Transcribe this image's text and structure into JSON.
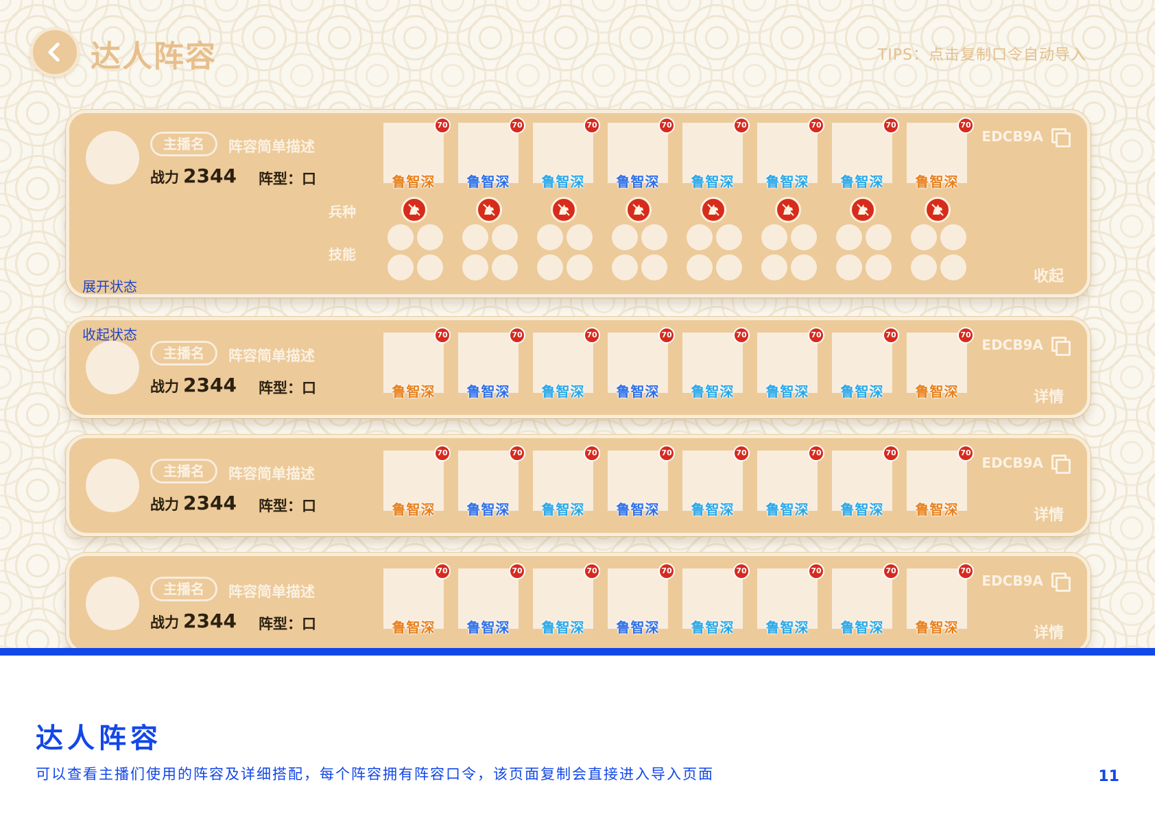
{
  "screen": {
    "title": "达人阵容",
    "tips": "TIPS：点击复制口令自动导入"
  },
  "cards": [
    {
      "state_label": "展开状态",
      "anchor": "主播名",
      "description": "阵容简单描述",
      "power_label": "战力",
      "power": "2344",
      "formation_label": "阵型：",
      "formation": "口",
      "code": "EDCB9A",
      "action": "收起",
      "troop_label": "兵种",
      "skill_label": "技能",
      "heroes": [
        {
          "name": "鲁智深",
          "level": "70",
          "color": "orange"
        },
        {
          "name": "鲁智深",
          "level": "70",
          "color": "blue"
        },
        {
          "name": "鲁智深",
          "level": "70",
          "color": "cyan"
        },
        {
          "name": "鲁智深",
          "level": "70",
          "color": "blue"
        },
        {
          "name": "鲁智深",
          "level": "70",
          "color": "cyan"
        },
        {
          "name": "鲁智深",
          "level": "70",
          "color": "cyan"
        },
        {
          "name": "鲁智深",
          "level": "70",
          "color": "cyan"
        },
        {
          "name": "鲁智深",
          "level": "70",
          "color": "orange"
        }
      ]
    },
    {
      "state_label": "收起状态",
      "anchor": "主播名",
      "description": "阵容简单描述",
      "power_label": "战力",
      "power": "2344",
      "formation_label": "阵型：",
      "formation": "口",
      "code": "EDCB9A",
      "action": "详情",
      "heroes": [
        {
          "name": "鲁智深",
          "level": "70",
          "color": "orange"
        },
        {
          "name": "鲁智深",
          "level": "70",
          "color": "blue"
        },
        {
          "name": "鲁智深",
          "level": "70",
          "color": "cyan"
        },
        {
          "name": "鲁智深",
          "level": "70",
          "color": "blue"
        },
        {
          "name": "鲁智深",
          "level": "70",
          "color": "cyan"
        },
        {
          "name": "鲁智深",
          "level": "70",
          "color": "cyan"
        },
        {
          "name": "鲁智深",
          "level": "70",
          "color": "cyan"
        },
        {
          "name": "鲁智深",
          "level": "70",
          "color": "orange"
        }
      ]
    },
    {
      "anchor": "主播名",
      "description": "阵容简单描述",
      "power_label": "战力",
      "power": "2344",
      "formation_label": "阵型：",
      "formation": "口",
      "code": "EDCB9A",
      "action": "详情",
      "heroes": [
        {
          "name": "鲁智深",
          "level": "70",
          "color": "orange"
        },
        {
          "name": "鲁智深",
          "level": "70",
          "color": "blue"
        },
        {
          "name": "鲁智深",
          "level": "70",
          "color": "cyan"
        },
        {
          "name": "鲁智深",
          "level": "70",
          "color": "blue"
        },
        {
          "name": "鲁智深",
          "level": "70",
          "color": "cyan"
        },
        {
          "name": "鲁智深",
          "level": "70",
          "color": "cyan"
        },
        {
          "name": "鲁智深",
          "level": "70",
          "color": "cyan"
        },
        {
          "name": "鲁智深",
          "level": "70",
          "color": "orange"
        }
      ]
    },
    {
      "anchor": "主播名",
      "description": "阵容简单描述",
      "power_label": "战力",
      "power": "2344",
      "formation_label": "阵型：",
      "formation": "口",
      "code": "EDCB9A",
      "action": "详情",
      "heroes": [
        {
          "name": "鲁智深",
          "level": "70",
          "color": "orange"
        },
        {
          "name": "鲁智深",
          "level": "70",
          "color": "blue"
        },
        {
          "name": "鲁智深",
          "level": "70",
          "color": "cyan"
        },
        {
          "name": "鲁智深",
          "level": "70",
          "color": "blue"
        },
        {
          "name": "鲁智深",
          "level": "70",
          "color": "cyan"
        },
        {
          "name": "鲁智深",
          "level": "70",
          "color": "cyan"
        },
        {
          "name": "鲁智深",
          "level": "70",
          "color": "cyan"
        },
        {
          "name": "鲁智深",
          "level": "70",
          "color": "orange"
        }
      ]
    }
  ],
  "caption": {
    "title": "达人阵容",
    "text": "可以查看主播们使用的阵容及详细搭配，每个阵容拥有阵容口令，该页面复制会直接进入导入页面",
    "page": "11"
  },
  "colors": {
    "card_bg": "#ecca9a",
    "accent_blue": "#1247e8",
    "hero_orange": "#e8801c",
    "hero_blue": "#2f70e8",
    "hero_cyan": "#2aa8e8",
    "badge_red": "#d62a1f"
  },
  "icons": {
    "back": "chevron-left-icon",
    "copy": "copy-icon",
    "troop": "cavalry-icon"
  }
}
